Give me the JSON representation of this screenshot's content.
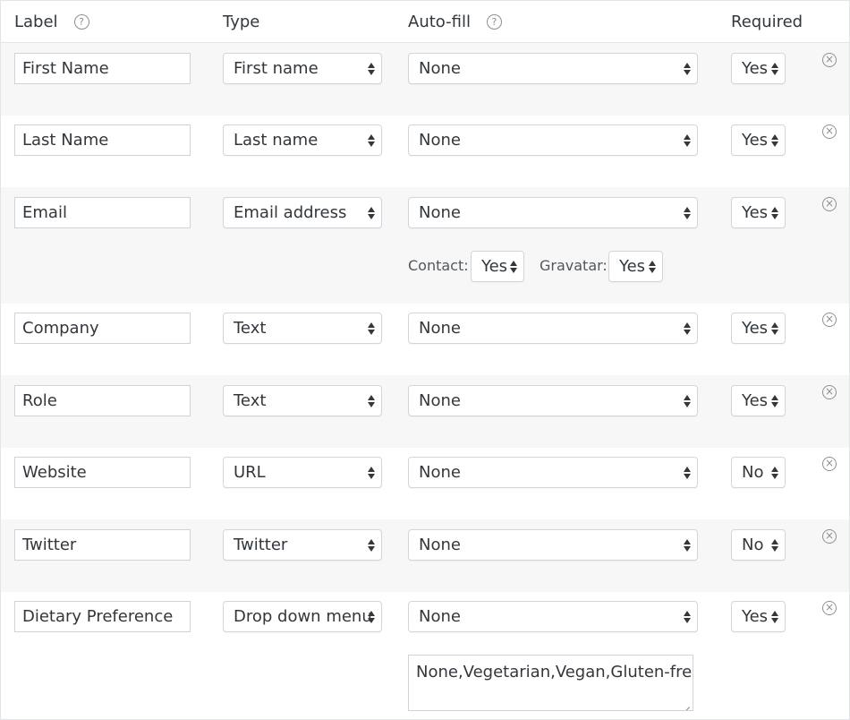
{
  "headers": {
    "label": "Label",
    "type": "Type",
    "autofill": "Auto-fill",
    "required": "Required",
    "help_glyph": "?",
    "help_icon": "question-circle-icon"
  },
  "remove_glyph": "×",
  "rows": [
    {
      "label": "First Name",
      "type": "First name",
      "autofill": "None",
      "required": "Yes"
    },
    {
      "label": "Last Name",
      "type": "Last name",
      "autofill": "None",
      "required": "Yes"
    },
    {
      "label": "Email",
      "type": "Email address",
      "autofill": "None",
      "required": "Yes",
      "extra": {
        "contact_label": "Contact:",
        "contact_value": "Yes",
        "gravatar_label": "Gravatar:",
        "gravatar_value": "Yes"
      }
    },
    {
      "label": "Company",
      "type": "Text",
      "autofill": "None",
      "required": "Yes"
    },
    {
      "label": "Role",
      "type": "Text",
      "autofill": "None",
      "required": "Yes"
    },
    {
      "label": "Website",
      "type": "URL",
      "autofill": "None",
      "required": "No"
    },
    {
      "label": "Twitter",
      "type": "Twitter",
      "autofill": "None",
      "required": "No"
    },
    {
      "label": "Dietary Preference",
      "type": "Drop down menu",
      "autofill": "None",
      "required": "Yes",
      "options_text": "None,Vegetarian,Vegan,Gluten-free"
    }
  ],
  "colors": {
    "alt_row": "#f7f7f7",
    "border": "#cfd2d6",
    "text": "#32373c",
    "muted": "#8c8f94"
  }
}
